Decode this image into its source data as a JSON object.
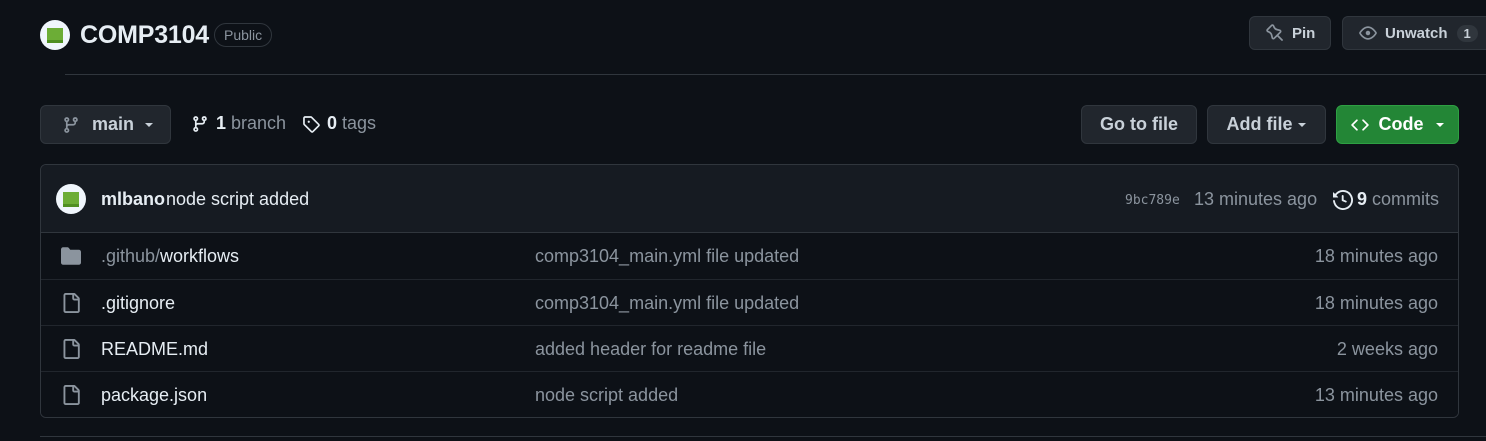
{
  "colors": {
    "background": "#0d1117",
    "panel": "#161b22",
    "border": "#30363d",
    "text": "#e6edf3",
    "muted": "#8b949e",
    "code_button": "#238636"
  },
  "header": {
    "repo_name": "COMP3104",
    "visibility": "Public",
    "pin_label": "Pin",
    "pin_icon": "pin-icon",
    "unwatch_label": "Unwatch",
    "unwatch_icon": "eye-icon",
    "watch_count": "1"
  },
  "branch_bar": {
    "current_branch": "main",
    "branch_count": "1",
    "branch_word": "branch",
    "tag_count": "0",
    "tag_word": "tags",
    "go_to_file_label": "Go to file",
    "add_file_label": "Add file",
    "code_label": "Code"
  },
  "latest_commit": {
    "author": "mlbano",
    "message": "node script added",
    "sha": "9bc789e",
    "time": "13 minutes ago",
    "commit_count": "9",
    "commit_word": "commits"
  },
  "files": [
    {
      "type": "folder",
      "icon": "folder-icon",
      "name_prefix": ".github/",
      "name": "workflows",
      "commit_message": "comp3104_main.yml file updated",
      "time": "18 minutes ago"
    },
    {
      "type": "file",
      "icon": "file-icon",
      "name_prefix": "",
      "name": ".gitignore",
      "commit_message": "comp3104_main.yml file updated",
      "time": "18 minutes ago"
    },
    {
      "type": "file",
      "icon": "file-icon",
      "name_prefix": "",
      "name": "README.md",
      "commit_message": "added header for readme file",
      "time": "2 weeks ago"
    },
    {
      "type": "file",
      "icon": "file-icon",
      "name_prefix": "",
      "name": "package.json",
      "commit_message": "node script added",
      "time": "13 minutes ago"
    }
  ]
}
